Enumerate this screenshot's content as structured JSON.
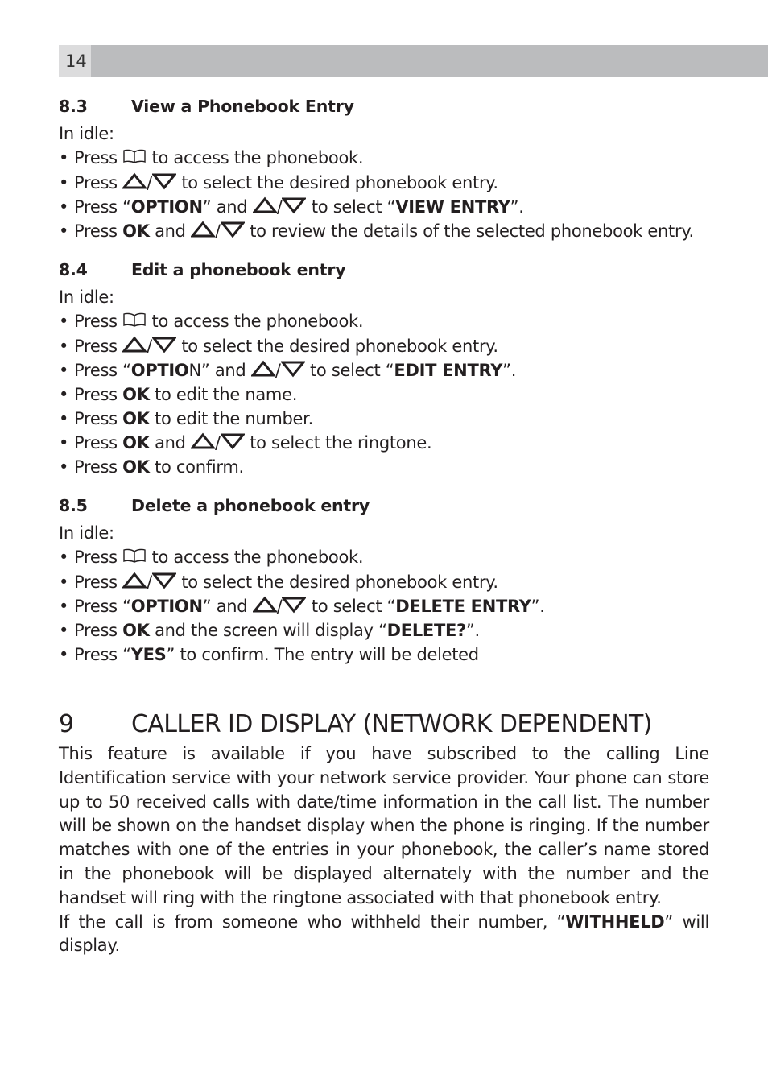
{
  "page": {
    "number": "14"
  },
  "icons": {
    "phonebook": "phonebook-icon",
    "up": "up-arrow-icon",
    "down": "down-arrow-icon"
  },
  "sections": [
    {
      "number": "8.3",
      "title": "View a Phonebook Entry",
      "intro": "In idle:",
      "steps": [
        {
          "pre": "Press ",
          "post": " to access the phonebook."
        },
        {
          "pre": "Press ",
          "post": " to select the desired phonebook entry."
        },
        {
          "pre": "Press “",
          "bold1": "OPTION",
          "mid": "” and ",
          "post": " to select “",
          "bold2": "VIEW ENTRY",
          "end": "”."
        },
        {
          "pre": "Press ",
          "bold1": "OK",
          "mid": " and ",
          "post": " to review the details of the selected phonebook entry."
        }
      ]
    },
    {
      "number": "8.4",
      "title": "Edit a phonebook entry",
      "intro": "In idle:",
      "steps": [
        {
          "pre": "Press ",
          "post": " to access the phonebook."
        },
        {
          "pre": "Press ",
          "post": " to select the desired phonebook entry."
        },
        {
          "pre": "Press “",
          "bold1": "OPTIO",
          "mid": "N” and ",
          "post": " to select “",
          "bold2": "EDIT ENTRY",
          "end": "”."
        },
        {
          "pre": "Press ",
          "bold1": "OK",
          "post": " to edit the name."
        },
        {
          "pre": "Press ",
          "bold1": "OK",
          "post": " to edit the number."
        },
        {
          "pre": "Press ",
          "bold1": "OK",
          "mid": " and ",
          "post": " to select the ringtone."
        },
        {
          "pre": "Press ",
          "bold1": "OK",
          "post": " to confirm."
        }
      ]
    },
    {
      "number": "8.5",
      "title": "Delete a phonebook entry",
      "intro": "In idle:",
      "steps": [
        {
          "pre": "Press ",
          "post": " to access the phonebook."
        },
        {
          "pre": "Press ",
          "post": " to select the desired phonebook entry."
        },
        {
          "pre": "Press “",
          "bold1": "OPTION",
          "mid": "” and ",
          "post": " to select “",
          "bold2": "DELETE ENTRY",
          "end": "”."
        },
        {
          "pre": "Press ",
          "bold1": "OK",
          "post": " and the screen will display “",
          "bold2": "DELETE?",
          "end": "”."
        },
        {
          "pre": "Press “",
          "bold1": "YES",
          "post": "” to confirm. The entry will be deleted"
        }
      ]
    }
  ],
  "chapter": {
    "number": "9",
    "title": "CALLER ID DISPLAY (NETWORK DEPENDENT)",
    "paragraph1": "This feature is available if you have subscribed to the calling Line Identification service with your network service provider. Your phone can store up to 50 received calls with date/time information in the call list. The number will be shown on the handset display when the phone is ringing. If the number matches with one of the entries in your phonebook, the caller’s name stored in the phonebook will be displayed alternately with the number and the handset will ring with the ringtone associated with that phonebook entry.",
    "paragraph2_pre": "If the call is from someone who withheld their number, “",
    "paragraph2_bold": "WITHHELD",
    "paragraph2_post": "” will display."
  }
}
